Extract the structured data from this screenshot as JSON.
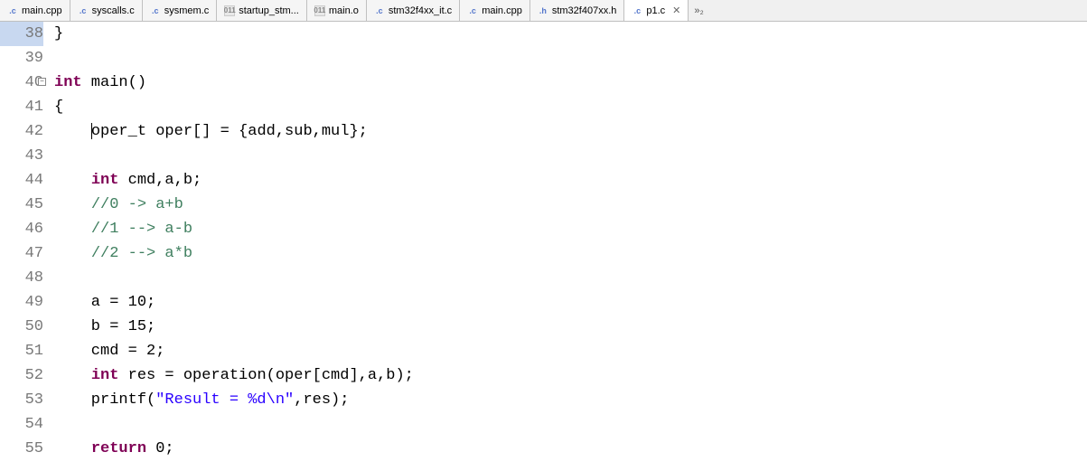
{
  "tabs": [
    {
      "label": "main.cpp",
      "iconType": "c"
    },
    {
      "label": "syscalls.c",
      "iconType": "c"
    },
    {
      "label": "sysmem.c",
      "iconType": "c"
    },
    {
      "label": "startup_stm...",
      "iconType": "o"
    },
    {
      "label": "main.o",
      "iconType": "o"
    },
    {
      "label": "stm32f4xx_it.c",
      "iconType": "c"
    },
    {
      "label": "main.cpp",
      "iconType": "c"
    },
    {
      "label": "stm32f407xx.h",
      "iconType": "h"
    },
    {
      "label": "p1.c",
      "iconType": "c",
      "active": true,
      "closable": true
    }
  ],
  "overflow": "»₂",
  "code": {
    "lines": [
      {
        "num": "38",
        "highlighted": true,
        "tokens": [
          {
            "t": "}",
            "c": ""
          }
        ]
      },
      {
        "num": "39",
        "tokens": []
      },
      {
        "num": "40",
        "fold": true,
        "tokens": [
          {
            "t": "int",
            "c": "kw"
          },
          {
            "t": " main()",
            "c": ""
          }
        ]
      },
      {
        "num": "41",
        "tokens": [
          {
            "t": "{",
            "c": ""
          }
        ]
      },
      {
        "num": "42",
        "cursor": true,
        "tokens": [
          {
            "t": "    oper_t oper[] = {add,sub,mul};",
            "c": ""
          }
        ]
      },
      {
        "num": "43",
        "tokens": []
      },
      {
        "num": "44",
        "tokens": [
          {
            "t": "    ",
            "c": ""
          },
          {
            "t": "int",
            "c": "kw"
          },
          {
            "t": " cmd,a,b;",
            "c": ""
          }
        ]
      },
      {
        "num": "45",
        "tokens": [
          {
            "t": "    ",
            "c": ""
          },
          {
            "t": "//0 -> a+b",
            "c": "comment"
          }
        ]
      },
      {
        "num": "46",
        "tokens": [
          {
            "t": "    ",
            "c": ""
          },
          {
            "t": "//1 --> a-b",
            "c": "comment"
          }
        ]
      },
      {
        "num": "47",
        "tokens": [
          {
            "t": "    ",
            "c": ""
          },
          {
            "t": "//2 --> a*b",
            "c": "comment"
          }
        ]
      },
      {
        "num": "48",
        "tokens": []
      },
      {
        "num": "49",
        "tokens": [
          {
            "t": "    a = 10;",
            "c": ""
          }
        ]
      },
      {
        "num": "50",
        "tokens": [
          {
            "t": "    b = 15;",
            "c": ""
          }
        ]
      },
      {
        "num": "51",
        "tokens": [
          {
            "t": "    cmd = 2;",
            "c": ""
          }
        ]
      },
      {
        "num": "52",
        "tokens": [
          {
            "t": "    ",
            "c": ""
          },
          {
            "t": "int",
            "c": "kw"
          },
          {
            "t": " res = operation(oper[cmd],a,b);",
            "c": ""
          }
        ]
      },
      {
        "num": "53",
        "tokens": [
          {
            "t": "    printf(",
            "c": ""
          },
          {
            "t": "\"Result = %d\\n\"",
            "c": "string"
          },
          {
            "t": ",res);",
            "c": ""
          }
        ]
      },
      {
        "num": "54",
        "tokens": []
      },
      {
        "num": "55",
        "tokens": [
          {
            "t": "    ",
            "c": ""
          },
          {
            "t": "return",
            "c": "kw"
          },
          {
            "t": " 0;",
            "c": ""
          }
        ]
      }
    ]
  }
}
